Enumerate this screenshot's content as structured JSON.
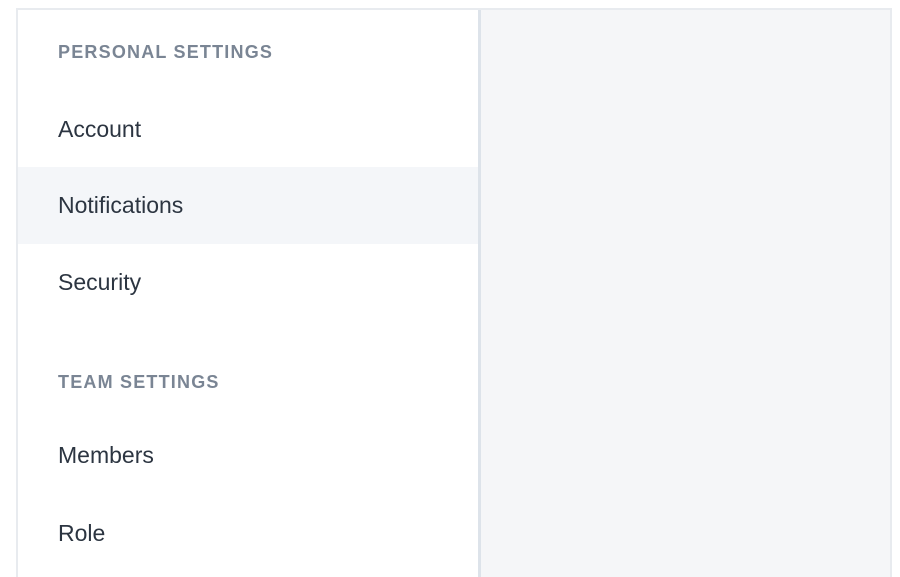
{
  "sidebar": {
    "sections": [
      {
        "heading": "PERSONAL SETTINGS",
        "items": [
          {
            "label": "Account",
            "active": false
          },
          {
            "label": "Notifications",
            "active": true
          },
          {
            "label": "Security",
            "active": false
          }
        ]
      },
      {
        "heading": "TEAM SETTINGS",
        "items": [
          {
            "label": "Members",
            "active": false
          },
          {
            "label": "Role",
            "active": false
          }
        ]
      }
    ]
  },
  "colors": {
    "active_item_bg": "#f4f6f9",
    "heading_text": "#7a8594",
    "item_text": "#2c3541",
    "content_bg": "#f5f6f8"
  }
}
